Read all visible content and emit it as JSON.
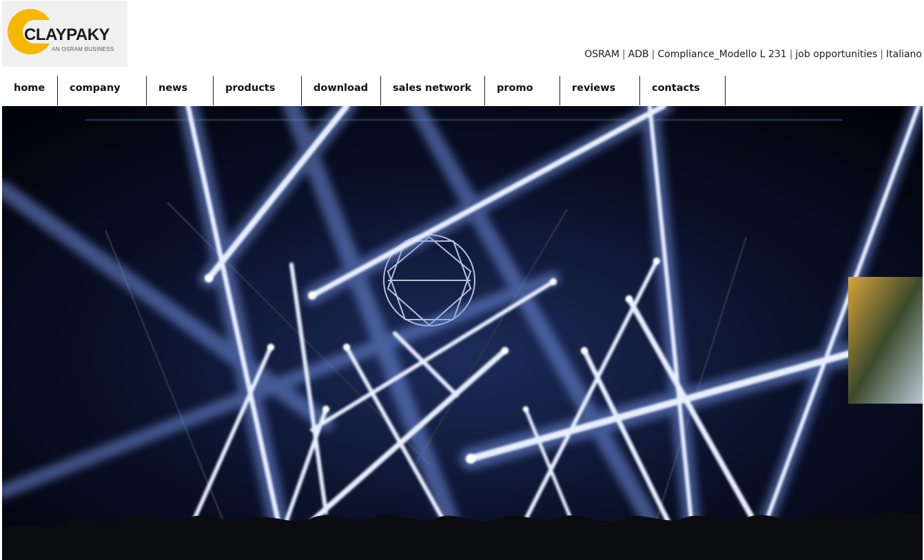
{
  "logo": {
    "brand": "CLAYPAKY",
    "tagline": "AN OSRAM BUSINESS"
  },
  "top_links": [
    "OSRAM",
    "ADB",
    "Compliance_Modello L 231",
    "job opportunities",
    "Italiano"
  ],
  "nav": [
    {
      "label": "home"
    },
    {
      "label": "company"
    },
    {
      "label": "news"
    },
    {
      "label": "products"
    },
    {
      "label": "download"
    },
    {
      "label": "sales network"
    },
    {
      "label": "promo"
    },
    {
      "label": "reviews"
    },
    {
      "label": "contacts"
    }
  ],
  "hero": {
    "description_icon": "concert-stage-light-beams-photo"
  }
}
